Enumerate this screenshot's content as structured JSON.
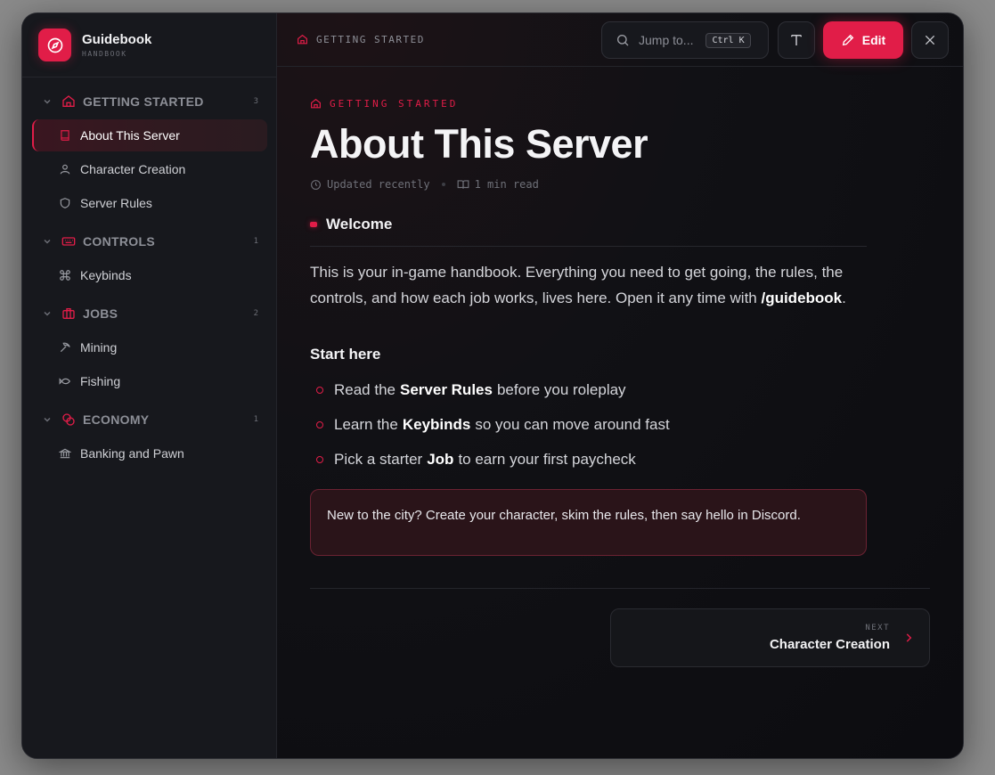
{
  "brand": {
    "title": "Guidebook",
    "subtitle": "HANDBOOK",
    "icon": "compass-icon"
  },
  "sidebar": {
    "sections": [
      {
        "label": "GETTING STARTED",
        "count": "3",
        "icon": "home-icon",
        "items": [
          {
            "label": "About This Server",
            "icon": "book-icon",
            "active": true
          },
          {
            "label": "Character Creation",
            "icon": "user-icon"
          },
          {
            "label": "Server Rules",
            "icon": "shield-icon"
          }
        ]
      },
      {
        "label": "CONTROLS",
        "count": "1",
        "icon": "keyboard-icon",
        "items": [
          {
            "label": "Keybinds",
            "icon": "command-icon"
          }
        ]
      },
      {
        "label": "JOBS",
        "count": "2",
        "icon": "briefcase-icon",
        "items": [
          {
            "label": "Mining",
            "icon": "pickaxe-icon"
          },
          {
            "label": "Fishing",
            "icon": "fish-icon"
          }
        ]
      },
      {
        "label": "ECONOMY",
        "count": "1",
        "icon": "coins-icon",
        "items": [
          {
            "label": "Banking and Pawn",
            "icon": "bank-icon"
          }
        ]
      }
    ]
  },
  "topbar": {
    "breadcrumb": "GETTING STARTED",
    "search_placeholder": "Jump to...",
    "search_shortcut": "Ctrl K",
    "edit_label": "Edit"
  },
  "article": {
    "eyebrow": "GETTING STARTED",
    "title": "About This Server",
    "updated": "Updated recently",
    "read_time": "1 min read",
    "section_title": "Welcome",
    "intro_part1": "This is your in-game handbook. Everything you need to get going, the rules, the controls, and how each job works, lives here. Open it any time with ",
    "intro_command": "/guidebook",
    "intro_end": ".",
    "subheading": "Start here",
    "list": [
      {
        "before": "Read the",
        "bold": "Server Rules",
        "after": "before you roleplay"
      },
      {
        "before": "Learn the",
        "bold": "Keybinds",
        "after": "so you can move around fast"
      },
      {
        "before": "Pick a starter",
        "bold": "Job",
        "after": "to earn your first paycheck"
      }
    ],
    "callout": "New to the city? Create your character, skim the rules, then say hello in Discord."
  },
  "next": {
    "eyebrow": "NEXT",
    "title": "Character Creation"
  },
  "colors": {
    "accent": "#e11d48",
    "background": "#0e0f13",
    "sidebar": "#17181d"
  }
}
